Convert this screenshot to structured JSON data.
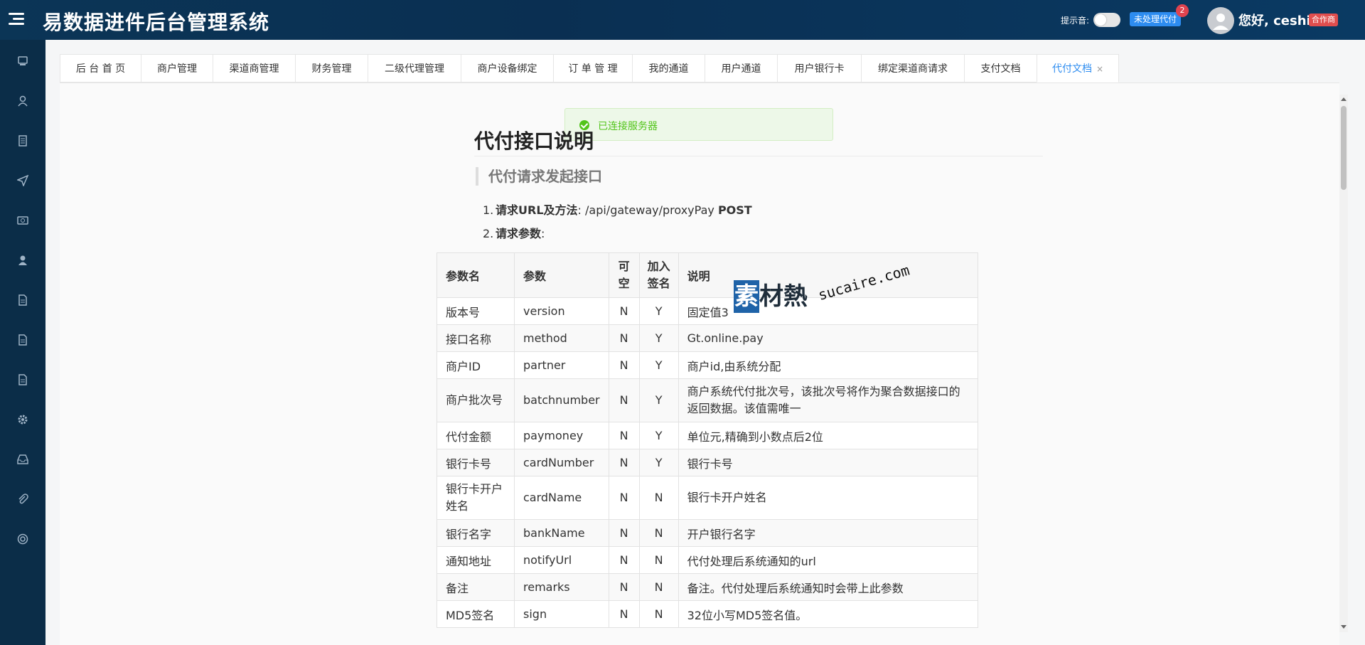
{
  "header": {
    "app_title": "易数据进件后台管理系统",
    "sound_label": "提示音:",
    "pending_label": "未处理代付",
    "pending_count": "2",
    "greeting": "您好, ceshi1",
    "role_badge": "合作商"
  },
  "sidebar": {
    "icons": [
      "server-icon",
      "user-icon",
      "document-icon",
      "send-icon",
      "payment-icon",
      "person-icon",
      "file-icon",
      "file-icon",
      "file-icon",
      "settings-icon",
      "inbox-icon",
      "attachment-icon",
      "help-icon"
    ]
  },
  "tabs": [
    {
      "label": "后 台 首 页"
    },
    {
      "label": "商户管理"
    },
    {
      "label": "渠道商管理"
    },
    {
      "label": "财务管理"
    },
    {
      "label": "二级代理管理"
    },
    {
      "label": "商户设备绑定"
    },
    {
      "label": "订 单 管 理"
    },
    {
      "label": "我的通道"
    },
    {
      "label": "用户通道"
    },
    {
      "label": "用户银行卡"
    },
    {
      "label": "绑定渠道商请求"
    },
    {
      "label": "支付文档"
    },
    {
      "label": "代付文档",
      "active": true,
      "close": "×"
    }
  ],
  "notification": {
    "message": "已连接服务器"
  },
  "doc": {
    "title": "代付接口说明",
    "subtitle": "代付请求发起接口",
    "item1_num": "1.",
    "item1_label": "请求URL及方法",
    "item1_sep": ":",
    "item1_url": "/api/gateway/proxyPay",
    "item1_method": "POST",
    "item2_num": "2.",
    "item2_label": "请求参数",
    "item2_sep": ":"
  },
  "params_table": {
    "headers": {
      "name": "参数名",
      "param": "参数",
      "nullable": "可空",
      "sign": "加入签名",
      "desc": "说明"
    },
    "rows": [
      {
        "name": "版本号",
        "param": "version",
        "nullable": "N",
        "sign": "Y",
        "desc": "固定值3"
      },
      {
        "name": "接口名称",
        "param": "method",
        "nullable": "N",
        "sign": "Y",
        "desc": "Gt.online.pay"
      },
      {
        "name": "商户ID",
        "param": "partner",
        "nullable": "N",
        "sign": "Y",
        "desc": "商户id,由系统分配"
      },
      {
        "name": "商户批次号",
        "param": "batchnumber",
        "nullable": "N",
        "sign": "Y",
        "desc": "商户系统代付批次号，该批次号将作为聚合数据接口的返回数据。该值需唯一"
      },
      {
        "name": "代付金额",
        "param": "paymoney",
        "nullable": "N",
        "sign": "Y",
        "desc": "单位元,精确到小数点后2位"
      },
      {
        "name": "银行卡号",
        "param": "cardNumber",
        "nullable": "N",
        "sign": "Y",
        "desc": "银行卡号"
      },
      {
        "name": "银行卡开户姓名",
        "param": "cardName",
        "nullable": "N",
        "sign": "N",
        "desc": "银行卡开户姓名"
      },
      {
        "name": "银行名字",
        "param": "bankName",
        "nullable": "N",
        "sign": "N",
        "desc": "开户银行名字"
      },
      {
        "name": "通知地址",
        "param": "notifyUrl",
        "nullable": "N",
        "sign": "N",
        "desc": "代付处理后系统通知的url"
      },
      {
        "name": "备注",
        "param": "remarks",
        "nullable": "N",
        "sign": "N",
        "desc": "备注。代付处理后系统通知时会带上此参数"
      },
      {
        "name": "MD5签名",
        "param": "sign",
        "nullable": "N",
        "sign": "N",
        "desc": "32位小写MD5签名值。"
      }
    ]
  },
  "watermark": {
    "box": "素",
    "cn": "材熱",
    "en": "sucaire.com"
  }
}
